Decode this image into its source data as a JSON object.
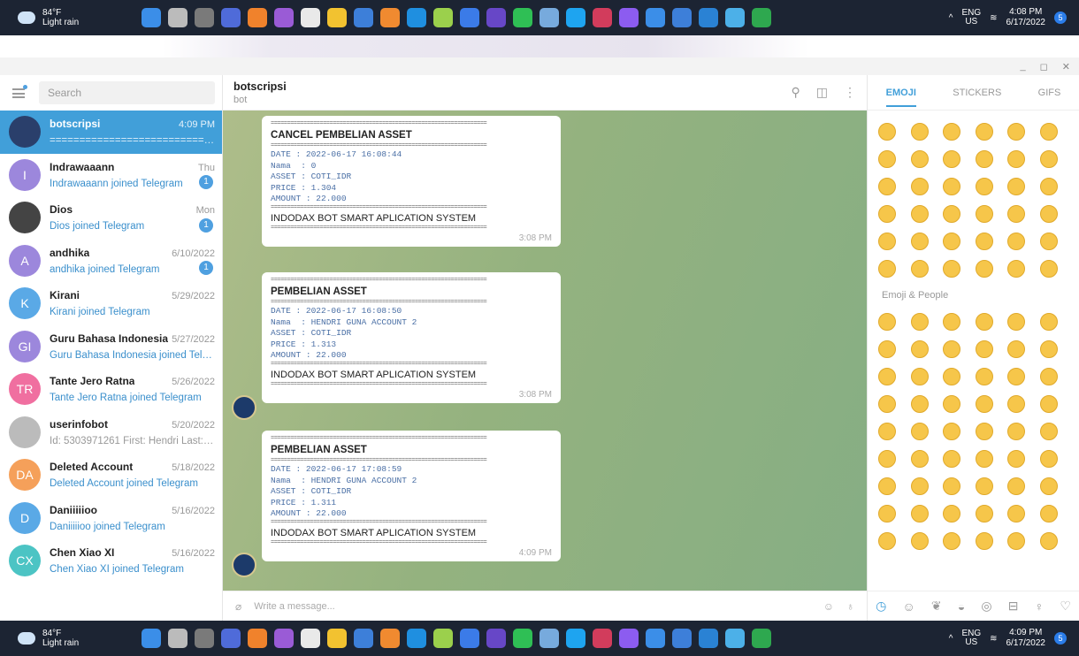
{
  "weather": {
    "temp": "84°F",
    "desc": "Light rain"
  },
  "taskbar_top": {
    "lang1": "ENG",
    "lang2": "US",
    "time": "4:08 PM",
    "date": "6/17/2022",
    "notif": "5"
  },
  "taskbar_bot": {
    "lang1": "ENG",
    "lang2": "US",
    "time": "4:09 PM",
    "date": "6/17/2022",
    "notif": "5"
  },
  "search": {
    "placeholder": "Search"
  },
  "chats": [
    {
      "name": "botscripsi",
      "date": "4:09 PM",
      "msg": "================================",
      "initials": "",
      "color": "#2a3f6b",
      "active": true
    },
    {
      "name": "Indrawaaann",
      "date": "Thu",
      "msg": "Indrawaaann joined Telegram",
      "initials": "I",
      "color": "#9c87dc",
      "badge": "1"
    },
    {
      "name": "Dios",
      "date": "Mon",
      "msg": "Dios joined Telegram",
      "initials": "",
      "color": "#444",
      "badge": "1"
    },
    {
      "name": "andhika",
      "date": "6/10/2022",
      "msg": "andhika joined Telegram",
      "initials": "A",
      "color": "#9c87dc",
      "badge": "1"
    },
    {
      "name": "Kirani",
      "date": "5/29/2022",
      "msg": "Kirani joined Telegram",
      "initials": "K",
      "color": "#5aa9e6"
    },
    {
      "name": "Guru Bahasa Indonesia",
      "date": "5/27/2022",
      "msg": "Guru Bahasa Indonesia joined Telegr...",
      "initials": "GI",
      "color": "#9c87dc"
    },
    {
      "name": "Tante Jero Ratna",
      "date": "5/26/2022",
      "msg": "Tante Jero Ratna joined Telegram",
      "initials": "TR",
      "color": "#f06fa0"
    },
    {
      "name": "userinfobot",
      "date": "5/20/2022",
      "msg": "Id: 5303971261 First: Hendri Last: Acc...",
      "initials": "",
      "color": "#bbb",
      "gray": true
    },
    {
      "name": "Deleted Account",
      "date": "5/18/2022",
      "msg": "Deleted Account joined Telegram",
      "initials": "DA",
      "color": "#f5a05a"
    },
    {
      "name": "Daniiiiioo",
      "date": "5/16/2022",
      "msg": "Daniiiiioo joined Telegram",
      "initials": "D",
      "color": "#5aa9e6"
    },
    {
      "name": "Chen Xiao XI",
      "date": "5/16/2022",
      "msg": "Chen Xiao XI joined Telegram",
      "initials": "CX",
      "color": "#4cc4c4"
    }
  ],
  "conversation": {
    "title": "botscripsi",
    "subtitle": "bot"
  },
  "messages": [
    {
      "title": "CANCEL PEMBELIAN ASSET",
      "date": "DATE : 2022-06-17 16:08:44",
      "nama": "Nama  : 0",
      "asset": "ASSET : COTI_IDR",
      "price": "PRICE : 1.304",
      "amount": "AMOUNT : 22.000",
      "footer": "INDODAX BOT SMART APLICATION SYSTEM",
      "time": "3:08 PM"
    },
    {
      "title": "PEMBELIAN ASSET",
      "date": "DATE : 2022-06-17 16:08:50",
      "nama": "Nama  : HENDRI GUNA ACCOUNT 2",
      "asset": "ASSET : COTI_IDR",
      "price": "PRICE : 1.313",
      "amount": "AMOUNT : 22.000",
      "footer": "INDODAX BOT SMART APLICATION SYSTEM",
      "time": "3:08 PM"
    },
    {
      "title": "PEMBELIAN ASSET",
      "date": "DATE : 2022-06-17 17:08:59",
      "nama": "Nama  : HENDRI GUNA ACCOUNT 2",
      "asset": "ASSET : COTI_IDR",
      "price": "PRICE : 1.311",
      "amount": "AMOUNT : 22.000",
      "footer": "INDODAX BOT SMART APLICATION SYSTEM",
      "time": "4:09 PM"
    }
  ],
  "separator": "==================================================================",
  "composer": {
    "placeholder": "Write a message..."
  },
  "emoji_panel": {
    "tabs": [
      "EMOJI",
      "STICKERS",
      "GIFS"
    ],
    "section": "Emoji & People"
  }
}
